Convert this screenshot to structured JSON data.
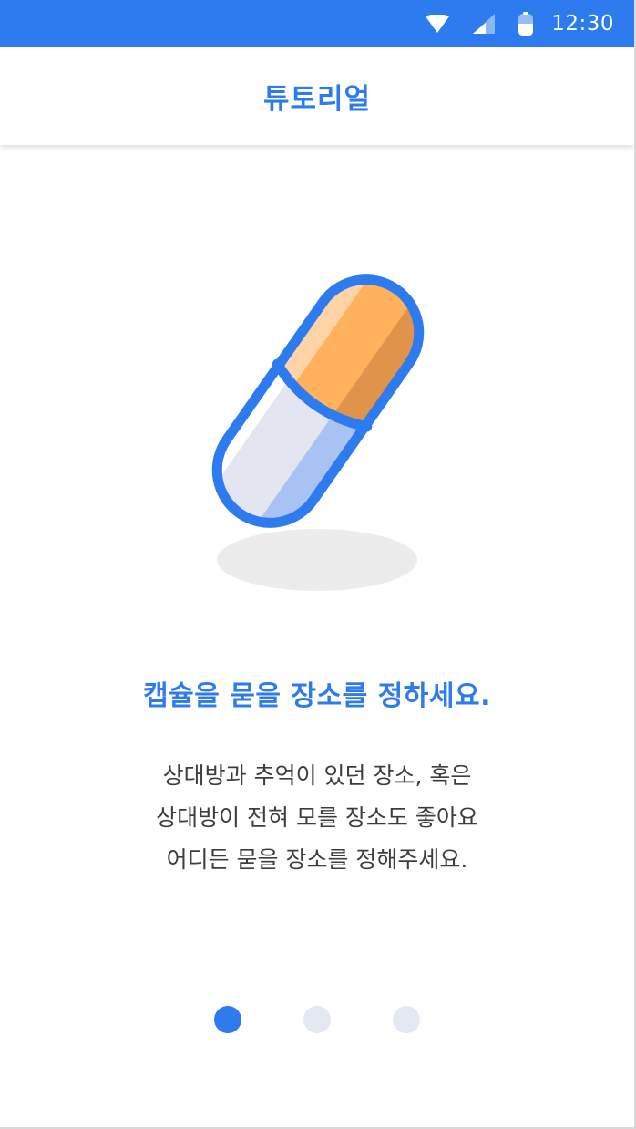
{
  "status_bar": {
    "time": "12:30",
    "icons": [
      "wifi-icon",
      "signal-icon",
      "battery-icon"
    ],
    "background": "#2d7bef"
  },
  "app_bar": {
    "title": "튜토리얼"
  },
  "illustration": {
    "icon": "capsule-icon",
    "colors": {
      "outline": "#2d7bef",
      "top_half": "#ffb15c",
      "top_shade": "#e0934a",
      "top_highlight": "#ffd3a6",
      "bottom_half": "#e3e6f1",
      "bottom_shade": "#a9c2f4",
      "shadow": "#ededed"
    }
  },
  "tutorial": {
    "headline": "캡슐을 묻을 장소를 정하세요.",
    "description_lines": [
      "상대방과 추억이 있던 장소, 혹은",
      "상대방이 전혀 모를 장소도 좋아요",
      "어디든 묻을 장소를 정해주세요."
    ]
  },
  "pager": {
    "total": 3,
    "active_index": 0,
    "active_color": "#2d7bef",
    "inactive_color": "#e4e8f3"
  }
}
